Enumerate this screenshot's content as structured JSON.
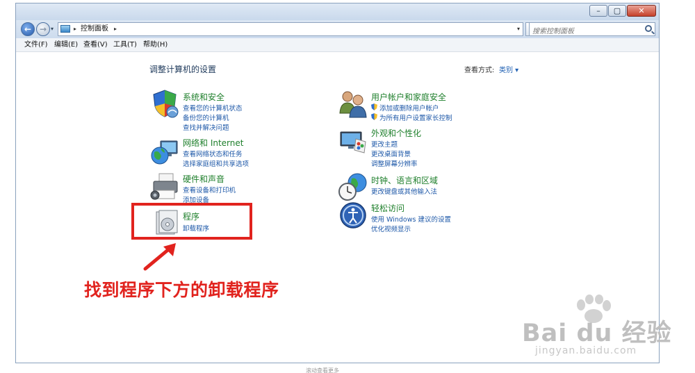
{
  "window": {
    "min_glyph": "–",
    "max_glyph": "▢",
    "close_glyph": "✕"
  },
  "nav": {
    "back_glyph": "←",
    "forward_glyph": "→",
    "dropdown_glyph": "▾"
  },
  "address": {
    "separator": "▸",
    "crumb": "控制面板",
    "dropdown_glyph": "▾",
    "refresh_glyph": "↻"
  },
  "search": {
    "placeholder": "搜索控制面板"
  },
  "menu": [
    {
      "label": "文件(F)"
    },
    {
      "label": "编辑(E)"
    },
    {
      "label": "查看(V)"
    },
    {
      "label": "工具(T)"
    },
    {
      "label": "帮助(H)"
    }
  ],
  "page": {
    "title": "调整计算机的设置",
    "view_by_label": "查看方式:",
    "view_by_value": "类别 ▾"
  },
  "categories": {
    "system": {
      "title": "系统和安全",
      "links": [
        "查看您的计算机状态",
        "备份您的计算机",
        "查找并解决问题"
      ],
      "icon": "shield-icon"
    },
    "network": {
      "title": "网络和 Internet",
      "links": [
        "查看网络状态和任务",
        "选择家庭组和共享选项"
      ],
      "icon": "network-globe-icon"
    },
    "hardware": {
      "title": "硬件和声音",
      "links": [
        "查看设备和打印机",
        "添加设备"
      ],
      "icon": "printer-icon"
    },
    "programs": {
      "title": "程序",
      "links": [
        "卸载程序"
      ],
      "icon": "programs-icon"
    },
    "users": {
      "title": "用户帐户和家庭安全",
      "links": [
        "添加或删除用户帐户",
        "为所有用户设置家长控制"
      ],
      "icon": "users-icon"
    },
    "appearance": {
      "title": "外观和个性化",
      "links": [
        "更改主题",
        "更改桌面背景",
        "调整屏幕分辨率"
      ],
      "icon": "monitor-palette-icon"
    },
    "clock": {
      "title": "时钟、语言和区域",
      "links": [
        "更改键盘或其他输入法"
      ],
      "icon": "clock-globe-icon"
    },
    "ease": {
      "title": "轻松访问",
      "links": [
        "使用 Windows 建议的设置",
        "优化视频显示"
      ],
      "icon": "ease-of-access-icon"
    }
  },
  "annotation": {
    "text": "找到程序下方的卸载程序",
    "color": "#e1231e"
  },
  "watermark": {
    "logo": "Bai du 经验",
    "url": "jingyan.baidu.com"
  },
  "footer": {
    "hint": "滚动查看更多"
  }
}
